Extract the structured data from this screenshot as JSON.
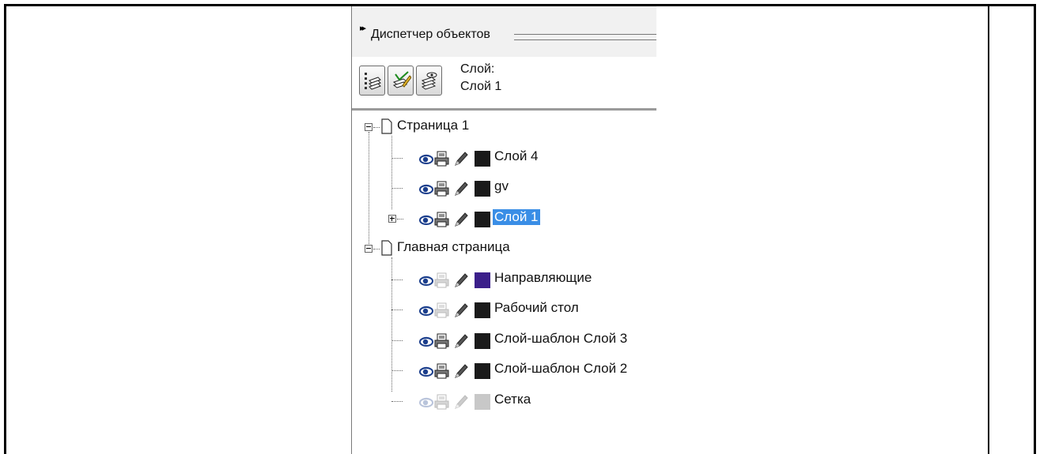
{
  "panel": {
    "title": "Диспетчер объектов",
    "layer_caption_line1": "Слой:",
    "layer_caption_line2": "Слой 1"
  },
  "toolbar": {
    "buttons": [
      "layer-list-icon",
      "edit-layers-icon",
      "layer-manager-icon"
    ]
  },
  "tree": {
    "pages": [
      {
        "label": "Страница 1",
        "layers": [
          {
            "label": "Слой 4",
            "color": "#1a1a1a",
            "printable": true,
            "visible": true,
            "expandable": false,
            "selected": false
          },
          {
            "label": "gv",
            "color": "#1a1a1a",
            "printable": true,
            "visible": true,
            "expandable": false,
            "selected": false
          },
          {
            "label": "Слой 1",
            "color": "#1a1a1a",
            "printable": true,
            "visible": true,
            "expandable": true,
            "selected": true
          }
        ]
      },
      {
        "label": "Главная страница",
        "layers": [
          {
            "label": "Направляющие",
            "color": "#3b1f8a",
            "printable": false,
            "visible": true,
            "expandable": false,
            "selected": false
          },
          {
            "label": "Рабочий стол",
            "color": "#1a1a1a",
            "printable": false,
            "visible": true,
            "expandable": false,
            "selected": false
          },
          {
            "label": "Слой-шаблон Слой 3",
            "color": "#1a1a1a",
            "printable": true,
            "visible": true,
            "expandable": false,
            "selected": false
          },
          {
            "label": "Слой-шаблон Слой 2",
            "color": "#1a1a1a",
            "printable": true,
            "visible": true,
            "expandable": false,
            "selected": false
          },
          {
            "label": "Сетка",
            "color": "#c8c8c8",
            "printable": false,
            "visible": false,
            "expandable": false,
            "selected": false
          }
        ]
      }
    ]
  },
  "colors": {
    "selection": "#3a8ee6",
    "header_bg": "#f1f1f1"
  }
}
